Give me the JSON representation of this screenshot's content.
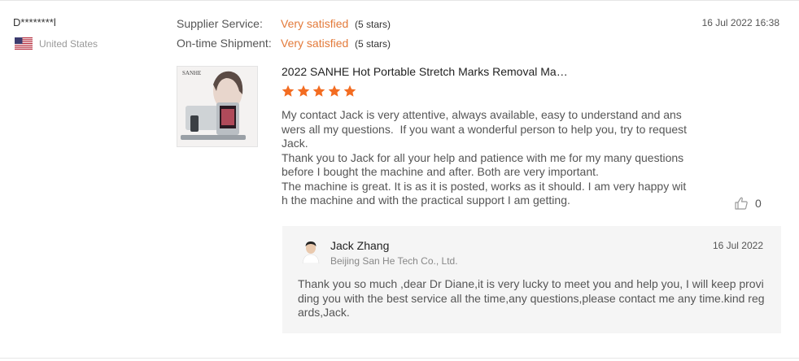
{
  "buyer": {
    "name": "D********l",
    "country": "United States",
    "flag_icon": "us-flag-icon"
  },
  "ratings": [
    {
      "label": "Supplier Service:",
      "value": "Very satisfied",
      "stars_text": "(5 stars)"
    },
    {
      "label": "On-time Shipment:",
      "value": "Very satisfied",
      "stars_text": "(5 stars)"
    }
  ],
  "review": {
    "date": "16 Jul 2022 16:38",
    "product_title": "2022 SANHE Hot Portable Stretch Marks Removal Ma…",
    "product_brand": "SANHE",
    "star_rating": 5,
    "text": "My contact Jack is very attentive, always available, easy to understand and answers all my questions.  If you want a wonderful person to help you, try to request Jack.\nThank you to Jack for all your help and patience with me for my many questions before I bought the machine and after. Both are very important.\nThe machine is great. It is as it is posted, works as it should. I am very happy with the machine and with the practical support I am getting.",
    "likes": "0"
  },
  "reply": {
    "name": "Jack Zhang",
    "company": "Beijing San He Tech Co., Ltd.",
    "date": "16 Jul 2022",
    "text": "Thank you so much ,dear Dr Diane,it is very lucky to meet you and help you, I will keep providing you with the best service all the time,any questions,please contact me any time.kind regards,Jack."
  },
  "colors": {
    "accent_orange": "#e37a3a",
    "star_orange": "#f36c21",
    "reply_bg": "#f5f5f5"
  }
}
